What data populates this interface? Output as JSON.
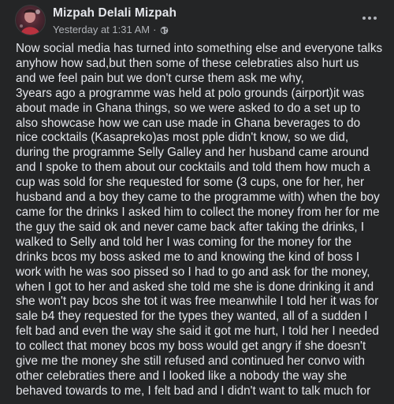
{
  "post": {
    "author": "Mizpah Delali Mizpah",
    "timestamp": "Yesterday at 1:31 AM",
    "separator": "·",
    "audience_icon": "globe-icon",
    "more_icon": "more-horizontal-icon",
    "body_lines": [
      "Now social media has turned into something else and everyone talks",
      "anyhow how sad,but then some of these celebraties also hurt us",
      "and we feel pain but we don't curse them ask me why,",
      " 3years ago a programme was held at polo grounds (airport)it was",
      "about made in Ghana things, so we were asked to do a set up to",
      "also showcase how we can use made in Ghana beverages  to do",
      "nice cocktails (Kasapreko)as most pple didn't know, so we did,",
      "during the programme Selly Galley and her husband came around",
      "and I spoke to them about our cocktails and told them how much a",
      "cup was sold for she requested for some (3 cups, one for her, her",
      "husband and a boy they came to the programme with) when the boy",
      "came for the drinks I asked him to collect the money from her for me",
      "the guy the said ok and never came back after taking the drinks, I",
      "walked to Selly and told her I was coming for the money for the",
      "drinks bcos my boss asked me to and knowing the kind of boss I",
      "work with he was soo pissed so I had to go and ask for the money,",
      "when I got to her and asked she told me she is done drinking it and",
      "she won't pay bcos she tot it was free meanwhile I told her it was for",
      "sale b4 they requested for the types they wanted, all of a sudden I",
      "felt bad and even the way she said it got me hurt, I told her I needed",
      "to collect that money bcos my boss would get angry if she doesn't",
      "give me the money she still refused and continued her convo with",
      "other celebraties there and I looked like a nobody the way she",
      "behaved towards to me, I felt bad and I didn't want to talk much for"
    ]
  },
  "colors": {
    "background": "#242526",
    "primary_text": "#e4e6eb",
    "secondary_text": "#b0b3b8"
  }
}
